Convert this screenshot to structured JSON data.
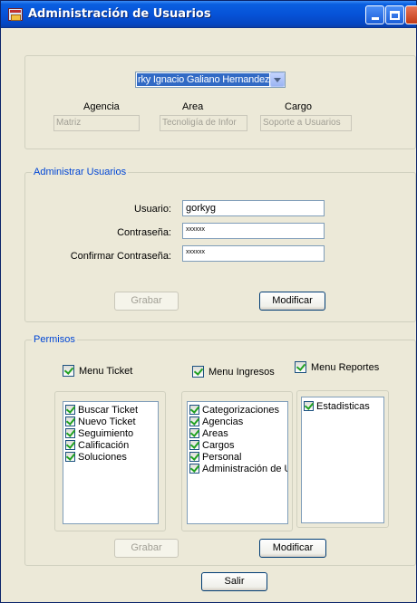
{
  "window": {
    "title": "Administración de Usuarios"
  },
  "user_selector": {
    "selected": "rky Ignacio Galiano Hernandez"
  },
  "info": {
    "agencia_label": "Agencia",
    "agencia_value": "Matriz",
    "area_label": "Area",
    "area_value": "Tecnoligía de Infor",
    "cargo_label": "Cargo",
    "cargo_value": "Soporte a Usuarios"
  },
  "admin_group": {
    "legend": "Administrar Usuarios",
    "usuario_label": "Usuario:",
    "usuario_value": "gorkyg",
    "contrasena_label": "Contraseña:",
    "contrasena_value": "xxxxxx",
    "confirmar_label": "Confirmar Contraseña:",
    "confirmar_value": "xxxxxx",
    "grabar_label": "Grabar",
    "modificar_label": "Modificar"
  },
  "permisos_group": {
    "legend": "Permisos",
    "menu_ticket": {
      "label": "Menu Ticket",
      "items": [
        "Buscar Ticket",
        "Nuevo Ticket",
        "Seguimiento",
        "Calificación",
        "Soluciones"
      ]
    },
    "menu_ingresos": {
      "label": "Menu Ingresos",
      "items": [
        "Categorizaciones",
        "Agencias",
        "Areas",
        "Cargos",
        "Personal",
        "Administración de U"
      ]
    },
    "menu_reportes": {
      "label": "Menu Reportes",
      "items": [
        "Estadisticas"
      ]
    },
    "grabar_label": "Grabar",
    "modificar_label": "Modificar"
  },
  "footer": {
    "salir_label": "Salir"
  },
  "colors": {
    "titlebar": "#0653d8",
    "legend": "#0046d5",
    "selection": "#316ac5",
    "check": "#21a121"
  }
}
